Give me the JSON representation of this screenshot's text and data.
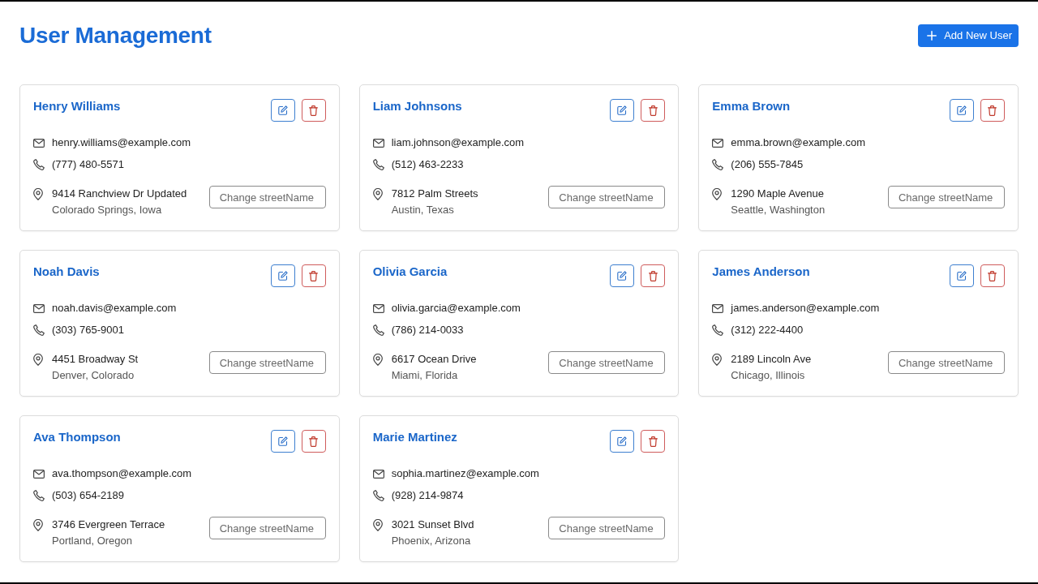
{
  "header": {
    "title": "User Management",
    "add_button": "Add New User"
  },
  "users": [
    {
      "name": "Henry Williams",
      "email": "henry.williams@example.com",
      "phone": "(777) 480-5571",
      "street": "9414 Ranchview Dr Updated",
      "city": "Colorado Springs, Iowa",
      "street_field": {
        "placeholder": "Change streetName"
      }
    },
    {
      "name": "Liam Johnsons",
      "email": "liam.johnson@example.com",
      "phone": "(512) 463-2233",
      "street": "7812 Palm Streets",
      "city": "Austin, Texas",
      "street_field": {
        "placeholder": "Change streetName"
      }
    },
    {
      "name": "Emma Brown",
      "email": "emma.brown@example.com",
      "phone": "(206) 555-7845",
      "street": "1290 Maple Avenue",
      "city": "Seattle, Washington",
      "street_field": {
        "placeholder": "Change streetName"
      }
    },
    {
      "name": "Noah Davis",
      "email": "noah.davis@example.com",
      "phone": "(303) 765-9001",
      "street": "4451 Broadway St",
      "city": "Denver, Colorado",
      "street_field": {
        "placeholder": "Change streetName"
      }
    },
    {
      "name": "Olivia Garcia",
      "email": "olivia.garcia@example.com",
      "phone": "(786) 214-0033",
      "street": "6617 Ocean Drive",
      "city": "Miami, Florida",
      "street_field": {
        "placeholder": "Change streetName"
      }
    },
    {
      "name": "James Anderson",
      "email": "james.anderson@example.com",
      "phone": "(312) 222-4400",
      "street": "2189 Lincoln Ave",
      "city": "Chicago, Illinois",
      "street_field": {
        "placeholder": "Change streetName"
      }
    },
    {
      "name": "Ava Thompson",
      "email": "ava.thompson@example.com",
      "phone": "(503) 654-2189",
      "street": "3746 Evergreen Terrace",
      "city": "Portland, Oregon",
      "street_field": {
        "placeholder": "Change streetName"
      }
    },
    {
      "name": "Marie Martinez",
      "email": "sophia.martinez@example.com",
      "phone": "(928) 214-9874",
      "street": "3021 Sunset Blvd",
      "city": "Phoenix, Arizona",
      "street_field": {
        "placeholder": "Change streetName"
      }
    }
  ]
}
